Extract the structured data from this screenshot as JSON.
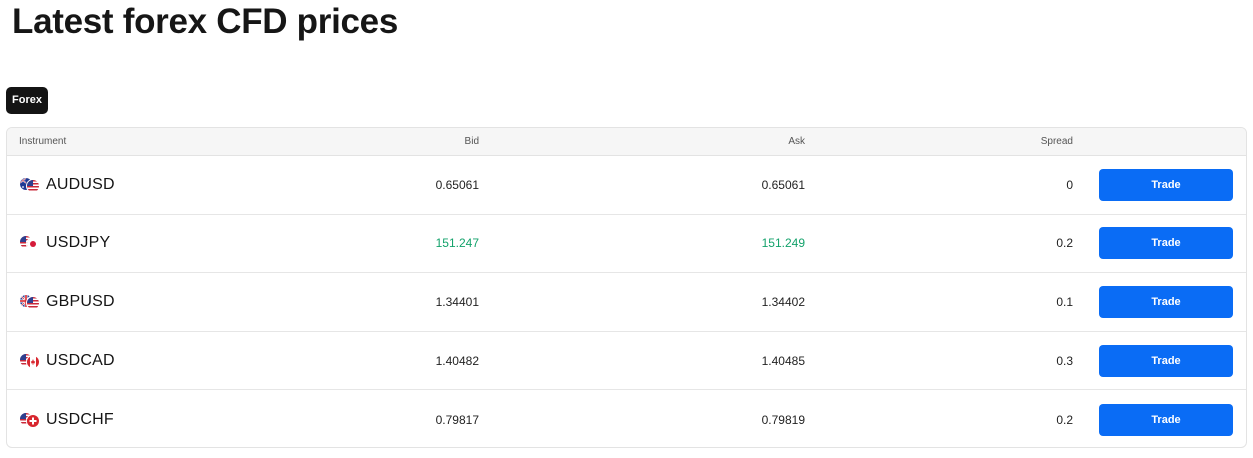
{
  "page_title": "Latest forex CFD prices",
  "tabs": [
    {
      "label": "Forex",
      "active": true
    }
  ],
  "table": {
    "headers": {
      "instrument": "Instrument",
      "bid": "Bid",
      "ask": "Ask",
      "spread": "Spread"
    },
    "rows": [
      {
        "instrument": "AUDUSD",
        "bid": "0.65061",
        "ask": "0.65061",
        "spread": "0",
        "trade": "Trade",
        "highlight": false,
        "flags": [
          "au-flag",
          "us-flag"
        ]
      },
      {
        "instrument": "USDJPY",
        "bid": "151.247",
        "ask": "151.249",
        "spread": "0.2",
        "trade": "Trade",
        "highlight": true,
        "flags": [
          "us-flag",
          "jp-flag"
        ]
      },
      {
        "instrument": "GBPUSD",
        "bid": "1.34401",
        "ask": "1.34402",
        "spread": "0.1",
        "trade": "Trade",
        "highlight": false,
        "flags": [
          "gb-flag",
          "us-flag"
        ]
      },
      {
        "instrument": "USDCAD",
        "bid": "1.40482",
        "ask": "1.40485",
        "spread": "0.3",
        "trade": "Trade",
        "highlight": false,
        "flags": [
          "us-flag",
          "ca-flag"
        ]
      },
      {
        "instrument": "USDCHF",
        "bid": "0.79817",
        "ask": "0.79819",
        "spread": "0.2",
        "trade": "Trade",
        "highlight": false,
        "flags": [
          "us-flag",
          "ch-flag"
        ]
      }
    ]
  },
  "colors": {
    "tab_bg": "#141414",
    "button": "#0a6cf5",
    "price_up": "#13a26b",
    "header_bg": "#f6f6f6"
  }
}
